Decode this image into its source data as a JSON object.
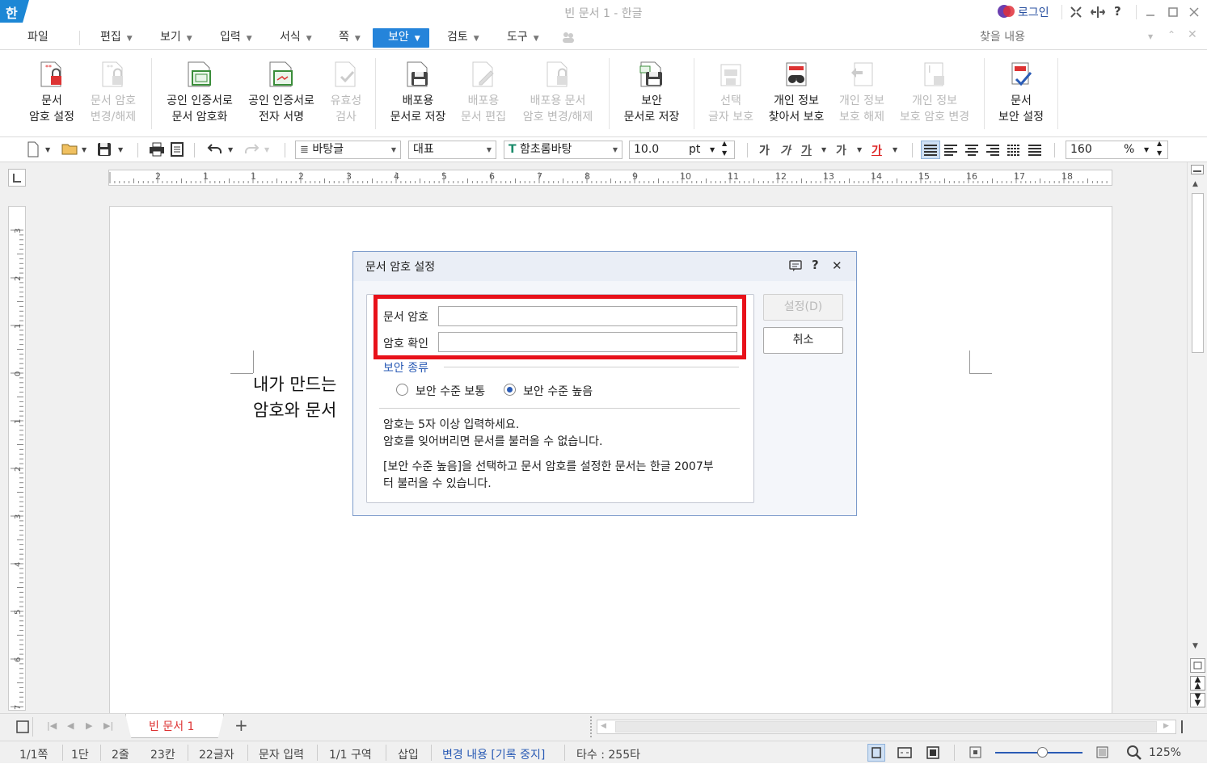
{
  "window": {
    "title": "빈 문서 1 - 한글",
    "app_logo": "한",
    "login_label": "로그인",
    "search_placeholder": "찾을 내용"
  },
  "menu": [
    "파일",
    "편집",
    "보기",
    "입력",
    "서식",
    "쪽",
    "보안",
    "검토",
    "도구"
  ],
  "ribbon": [
    {
      "line1": "문서",
      "line2": "암호 설정",
      "icon": "doc-lock-icon",
      "enabled": true
    },
    {
      "line1": "문서 암호",
      "line2": "변경/해제",
      "icon": "doc-lock-change-icon",
      "enabled": false
    },
    {
      "line1": "공인 인증서로",
      "line2": "문서 암호화",
      "icon": "cert-encrypt-icon",
      "enabled": true
    },
    {
      "line1": "공인 인증서로",
      "line2": "전자 서명",
      "icon": "cert-sign-icon",
      "enabled": true
    },
    {
      "line1": "유효성",
      "line2": "검사",
      "icon": "validate-icon",
      "enabled": false
    },
    {
      "line1": "배포용",
      "line2": "문서로 저장",
      "icon": "save-distribute-icon",
      "enabled": true
    },
    {
      "line1": "배포용",
      "line2": "문서 편집",
      "icon": "edit-distribute-icon",
      "enabled": false
    },
    {
      "line1": "배포용 문서",
      "line2": "암호 변경/해제",
      "icon": "distribute-lock-icon",
      "enabled": false
    },
    {
      "line1": "보안",
      "line2": "문서로 저장",
      "icon": "save-secure-icon",
      "enabled": true
    },
    {
      "line1": "선택",
      "line2": "글자 보호",
      "icon": "protect-chars-icon",
      "enabled": false
    },
    {
      "line1": "개인 정보",
      "line2": "찾아서 보호",
      "icon": "find-privacy-icon",
      "enabled": true
    },
    {
      "line1": "개인 정보",
      "line2": "보호 해제",
      "icon": "unprotect-privacy-icon",
      "enabled": false
    },
    {
      "line1": "개인 정보",
      "line2": "보호 암호 변경",
      "icon": "privacy-password-icon",
      "enabled": false
    },
    {
      "line1": "문서",
      "line2": "보안 설정",
      "icon": "doc-security-settings-icon",
      "enabled": true
    }
  ],
  "format": {
    "style": "바탕글",
    "lang": "대표",
    "font": "함초롬바탕",
    "size": "10.0",
    "unit": "pt",
    "zoom": "160",
    "zoom_unit": "%"
  },
  "ruler": {
    "h_ticks": [
      "2",
      "1",
      "1",
      "2",
      "3",
      "4",
      "5",
      "6",
      "7",
      "8",
      "9",
      "10",
      "11",
      "12",
      "13",
      "14",
      "15",
      "16",
      "17",
      "18"
    ],
    "v_ticks": [
      "3",
      "2",
      "1",
      "0",
      "1",
      "2",
      "3",
      "4",
      "5",
      "6",
      "7"
    ]
  },
  "document": {
    "line1": "내가 만드는",
    "line2": "암호와 문서"
  },
  "dialog": {
    "title": "문서 암호 설정",
    "password_label": "문서 암호",
    "confirm_label": "암호 확인",
    "set_button": "설정(D)",
    "cancel_button": "취소",
    "security_type_label": "보안 종류",
    "radio_normal": "보안 수준 보통",
    "radio_high": "보안 수준 높음",
    "selected": "high",
    "info1": "암호는 5자 이상 입력하세요.",
    "info2": "암호를 잊어버리면 문서를 불러올 수 없습니다.",
    "info3a": "[보안 수준 높음]을 선택하고 문서 암호를 설정한 문서는 한글 2007부",
    "info3b": "터 불러올 수 있습니다.",
    "highlight_color": "#e8111a"
  },
  "tabs": {
    "doc_tab": "빈 문서 1",
    "add": "+"
  },
  "status": {
    "page": "1/1쪽",
    "col": "1단",
    "line": "2줄",
    "pos": "23칸",
    "chars": "22글자",
    "mode": "문자 입력",
    "section": "1/1 구역",
    "insert": "삽입",
    "track": "변경 내용 [기록 중지]",
    "typing": "타수 : 255타",
    "zoom": "125%"
  },
  "colors": {
    "accent": "#2584da",
    "dialog_border": "#7c9bcb"
  }
}
